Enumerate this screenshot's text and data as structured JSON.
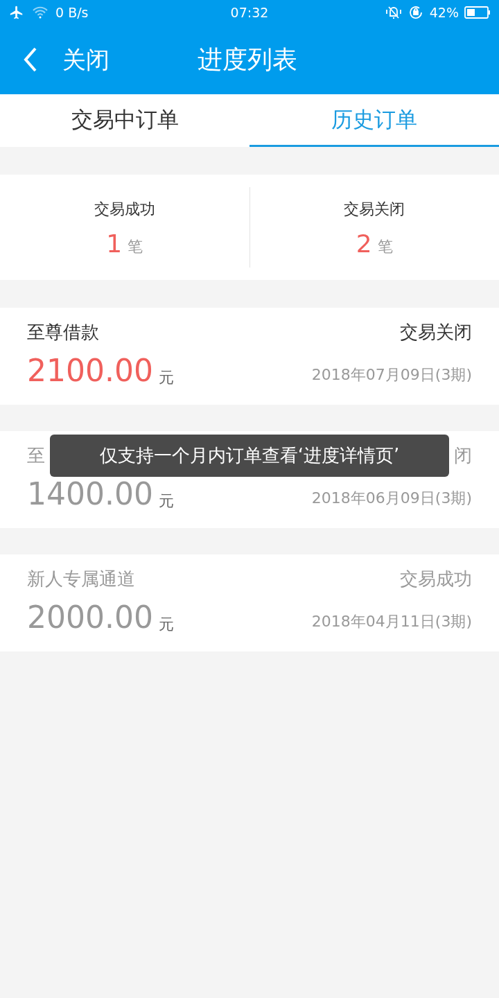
{
  "status_bar": {
    "speed": "0 B/s",
    "time": "07:32",
    "battery": "42%"
  },
  "header": {
    "back": "关闭",
    "title": "进度列表"
  },
  "tabs": [
    {
      "label": "交易中订单",
      "selected": false
    },
    {
      "label": "历史订单",
      "selected": true
    }
  ],
  "summary": [
    {
      "label": "交易成功",
      "count": "1",
      "unit": "笔"
    },
    {
      "label": "交易关闭",
      "count": "2",
      "unit": "笔"
    }
  ],
  "orders": [
    {
      "name": "至尊借款",
      "status": "交易关闭",
      "amount": "2100.00",
      "unit": "元",
      "date": "2018年07月09日(3期)",
      "disabled": false
    },
    {
      "name": "至",
      "status": "闭",
      "amount": "1400.00",
      "unit": "元",
      "date": "2018年06月09日(3期)",
      "disabled": true
    },
    {
      "name": "新人专属通道",
      "status": "交易成功",
      "amount": "2000.00",
      "unit": "元",
      "date": "2018年04月11日(3期)",
      "disabled": true
    }
  ],
  "toast": "仅支持一个月内订单查看‘进度详情页’"
}
